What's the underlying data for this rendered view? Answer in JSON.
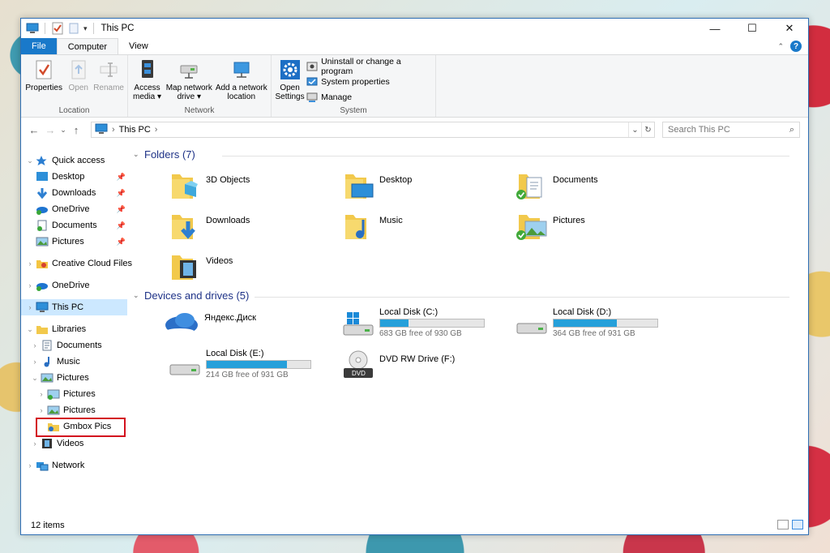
{
  "window": {
    "title": "This PC"
  },
  "ribbon": {
    "tabs": [
      "File",
      "Computer",
      "View"
    ],
    "location": {
      "label": "Location",
      "properties": "Properties",
      "open": "Open",
      "rename": "Rename"
    },
    "network": {
      "label": "Network",
      "access_media": [
        "Access",
        "media ▾"
      ],
      "map_drive": [
        "Map network",
        "drive ▾"
      ],
      "add_location": [
        "Add a network",
        "location"
      ]
    },
    "system": {
      "label": "System",
      "open_settings": [
        "Open",
        "Settings"
      ],
      "uninstall": "Uninstall or change a program",
      "system_properties": "System properties",
      "manage": "Manage"
    }
  },
  "address": {
    "crumb": "This PC",
    "search_placeholder": "Search This PC"
  },
  "nav": {
    "quick_access": "Quick access",
    "qa_items": [
      "Desktop",
      "Downloads",
      "OneDrive",
      "Documents",
      "Pictures"
    ],
    "creative_cloud": "Creative Cloud Files",
    "onedrive": "OneDrive",
    "this_pc": "This PC",
    "libraries": "Libraries",
    "lib_documents": "Documents",
    "lib_music": "Music",
    "lib_pictures": "Pictures",
    "pic_sub1": "Pictures",
    "pic_sub2": "Pictures",
    "gmbox": "Gmbox Pics",
    "lib_videos": "Videos",
    "network": "Network"
  },
  "folders": {
    "header": "Folders (7)",
    "items": [
      "3D Objects",
      "Desktop",
      "Documents",
      "Downloads",
      "Music",
      "Pictures",
      "Videos"
    ]
  },
  "devices": {
    "header": "Devices and drives (5)",
    "yandex": "Яндекс.Диск",
    "c": {
      "name": "Local Disk (C:)",
      "free": "683 GB free of 930 GB",
      "used_fraction": 0.27
    },
    "d": {
      "name": "Local Disk (D:)",
      "free": "364 GB free of 931 GB",
      "used_fraction": 0.61
    },
    "e": {
      "name": "Local Disk (E:)",
      "free": "214 GB free of 931 GB",
      "used_fraction": 0.77
    },
    "f": {
      "name": "DVD RW Drive (F:)"
    }
  },
  "status": {
    "count": "12 items"
  },
  "colors": {
    "accent": "#1979ca",
    "bar": "#26a0da",
    "selected": "#cce8ff",
    "highlight": "#d3121e"
  }
}
